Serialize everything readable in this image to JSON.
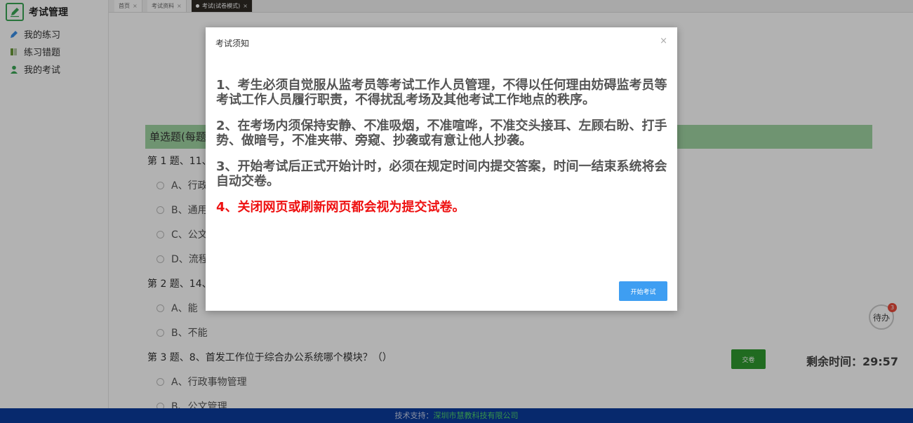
{
  "sidebar": {
    "brand_title": "考试管理",
    "items": [
      {
        "label": "我的练习",
        "icon": "pen-icon",
        "color": "#3a8ee6"
      },
      {
        "label": "练习错题",
        "icon": "book-icon",
        "color": "#6b9a3a"
      },
      {
        "label": "我的考试",
        "icon": "user-icon",
        "color": "#3aa655"
      }
    ]
  },
  "tabs": [
    {
      "label": "首页"
    },
    {
      "label": "考试资料"
    },
    {
      "label": "考试(试卷模式)"
    }
  ],
  "exam": {
    "section_title": "单选题(每题",
    "questions": [
      {
        "title": "第 1 题、11、",
        "options": [
          "A、行政",
          "B、通用",
          "C、公文",
          "D、流程"
        ]
      },
      {
        "title": "第 2 题、14、",
        "options": [
          "A、能",
          "B、不能"
        ]
      },
      {
        "title": "第 3 题、8、首发工作位于综合办公系统哪个模块？（）",
        "options": [
          "A、行政事物管理",
          "B、公文管理"
        ]
      }
    ],
    "submit_label": "交卷",
    "timer_label": "剩余时间：",
    "timer_value": "29:57",
    "todo_label": "待办",
    "todo_count": "3"
  },
  "footer": {
    "prefix": "技术支持：",
    "company": "深圳市慧教科技有限公司"
  },
  "modal": {
    "title": "考试须知",
    "close": "×",
    "rules": [
      "1、考生必须自觉服从监考员等考试工作人员管理，不得以任何理由妨碍监考员等考试工作人员履行职责，不得扰乱考场及其他考试工作地点的秩序。",
      "2、在考场内须保持安静、不准吸烟，不准喧哗，不准交头接耳、左顾右盼、打手势、做暗号，不准夹带、旁窥、抄袭或有意让他人抄袭。",
      "3、开始考试后正式开始计时，必须在规定时间内提交答案，时间一结束系统将会自动交卷。",
      "4、关闭网页或刷新网页都会视为提交试卷。"
    ],
    "start_label": "开始考试"
  }
}
